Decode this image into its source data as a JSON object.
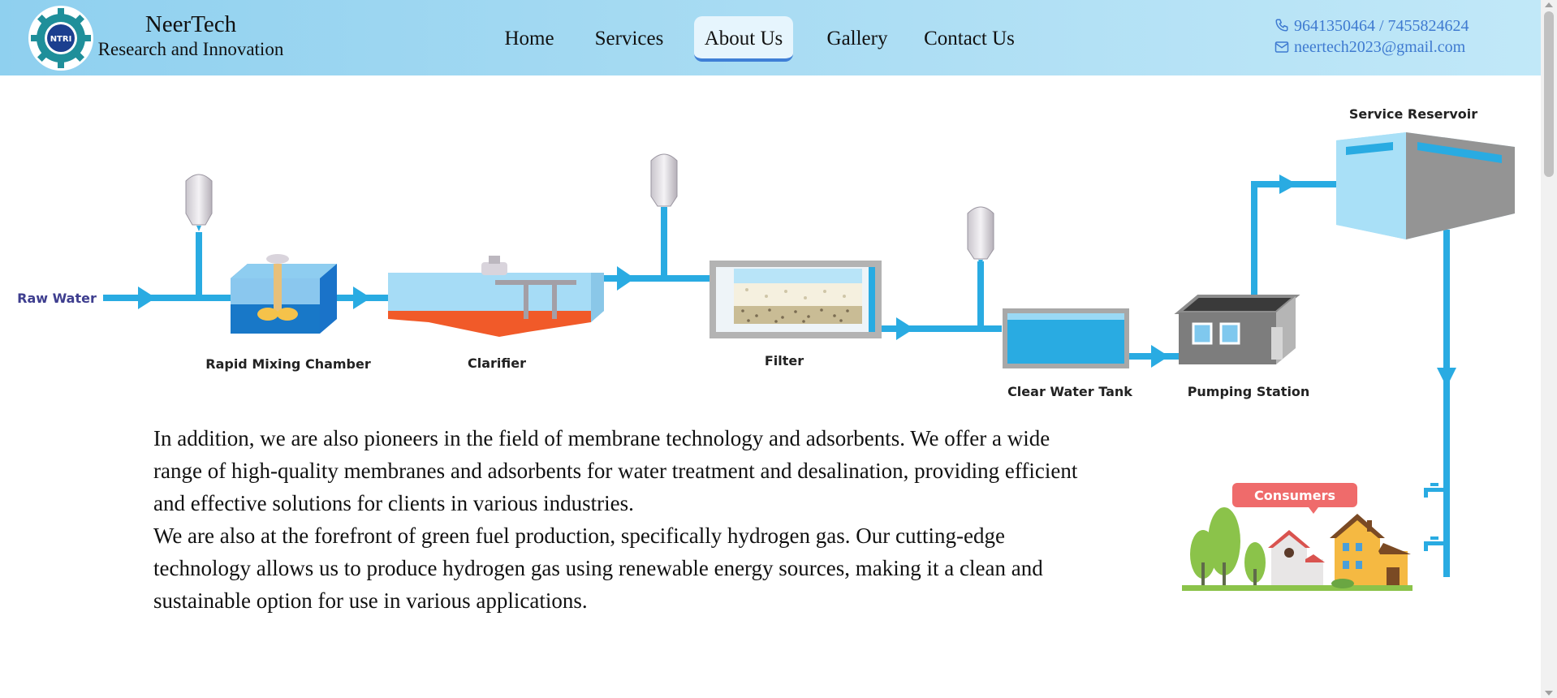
{
  "header": {
    "logo_text": "NTRI",
    "brand_name": "NeerTech",
    "brand_subtitle": "Research and Innovation",
    "nav": [
      {
        "label": "Home",
        "active": false
      },
      {
        "label": "Services",
        "active": false
      },
      {
        "label": "About Us",
        "active": true
      },
      {
        "label": "Gallery",
        "active": false
      },
      {
        "label": "Contact Us",
        "active": false
      }
    ],
    "phone": "9641350464 / 7455824624",
    "email": "neertech2023@gmail.com",
    "phone_icon": "phone-icon",
    "email_icon": "mail-icon"
  },
  "diagram": {
    "labels": {
      "raw_water": "Raw Water",
      "rapid_mixing": "Rapid Mixing Chamber",
      "clarifier": "Clarifier",
      "filter": "Filter",
      "clear_water_tank": "Clear Water Tank",
      "pumping_station": "Pumping Station",
      "service_reservoir": "Service Reservoir",
      "consumers": "Consumers"
    }
  },
  "content": {
    "paragraph1": "In addition, we are also pioneers in the field of membrane technology and adsorbents. We offer a wide range of high-quality membranes and adsorbents for water treatment and desalination, providing efficient and effective solutions for clients in various industries.",
    "paragraph2": "We are also at the forefront of green fuel production, specifically hydrogen gas. Our cutting-edge technology allows us to produce hydrogen gas using renewable energy sources, making it a clean and sustainable option for use in various applications."
  },
  "colors": {
    "pipe": "#29abe2",
    "accent": "#3f7fd6",
    "clarifier_sludge": "#f15a29",
    "consumers_badge": "#ef6b6b"
  }
}
